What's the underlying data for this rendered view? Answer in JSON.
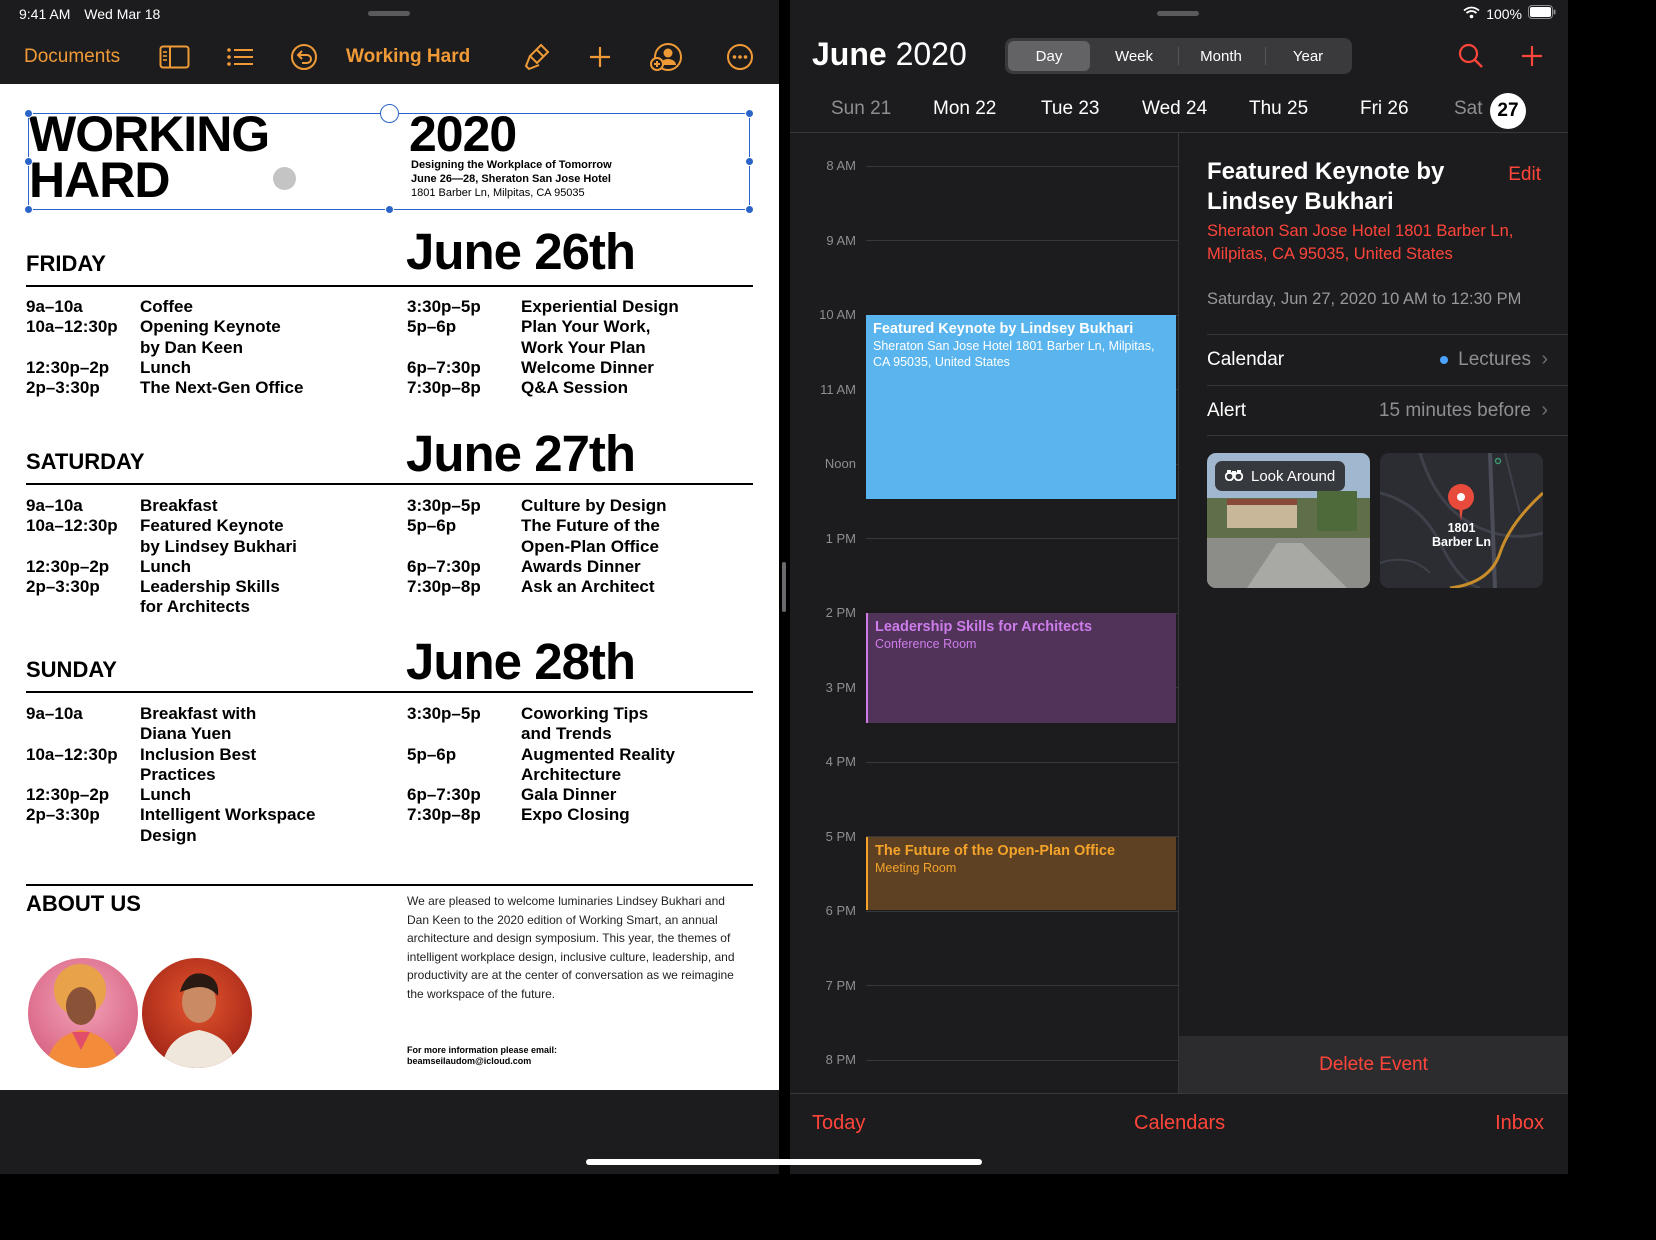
{
  "status": {
    "time": "9:41 AM",
    "date": "Wed Mar 18",
    "battery": "100%"
  },
  "pages": {
    "toolbar": {
      "documents": "Documents",
      "title": "Working Hard"
    },
    "doc": {
      "title_line1": "WORKING",
      "title_line2": "HARD",
      "year": "2020",
      "subtitle": "Designing the Workplace of Tomorrow",
      "subtitle2": "June 26—28, Sheraton San Jose Hotel",
      "address": "1801 Barber Ln, Milpitas, CA 95035",
      "days": [
        {
          "name": "FRIDAY",
          "date": "June 26th",
          "left_times": "9a–10a\n10a–12:30p\n\n12:30p–2p\n2p–3:30p",
          "left_events": "Coffee\nOpening Keynote\nby Dan Keen\nLunch\nThe Next-Gen Office",
          "right_times": "3:30p–5p\n5p–6p\n\n6p–7:30p\n7:30p–8p",
          "right_events": "Experiential Design\nPlan Your Work,\nWork Your Plan\nWelcome Dinner\nQ&A Session"
        },
        {
          "name": "SATURDAY",
          "date": "June 27th",
          "left_times": "9a–10a\n10a–12:30p\n\n12:30p–2p\n2p–3:30p",
          "left_events": "Breakfast\nFeatured Keynote\nby Lindsey Bukhari\nLunch\nLeadership Skills\nfor Architects",
          "right_times": "3:30p–5p\n5p–6p\n\n6p–7:30p\n7:30p–8p",
          "right_events": "Culture by Design\nThe Future of the\nOpen-Plan Office\nAwards Dinner\nAsk an Architect"
        },
        {
          "name": "SUNDAY",
          "date": "June 28th",
          "left_times": "9a–10a\n\n10a–12:30p\n\n12:30p–2p\n2p–3:30p",
          "left_events": "Breakfast with\nDiana Yuen\nInclusion Best\nPractices\nLunch\nIntelligent Workspace\nDesign",
          "right_times": "3:30p–5p\n\n5p–6p\n\n6p–7:30p\n7:30p–8p",
          "right_events": "Coworking Tips\nand Trends\nAugmented Reality\nArchitecture\nGala Dinner\nExpo Closing"
        }
      ],
      "about_heading": "ABOUT US",
      "about_text": "We are pleased to welcome luminaries Lindsey Bukhari and Dan Keen to the 2020 edition of Working Smart, an annual architecture and design symposium. This year, the themes of intelligent workplace design, inclusive culture, leadership, and productivity are at the center of conversation as we reimagine the workspace of the future.",
      "info_label": "For more information please email:",
      "info_email": "beamseilaudom@icloud.com"
    }
  },
  "calendar": {
    "month": "June",
    "year": "2020",
    "views": [
      "Day",
      "Week",
      "Month",
      "Year"
    ],
    "active_view": "Day",
    "days": [
      "Sun 21",
      "Mon 22",
      "Tue 23",
      "Wed 24",
      "Thu 25",
      "Fri 26",
      "Sat"
    ],
    "today_num": "27",
    "hours": [
      "8 AM",
      "9 AM",
      "10 AM",
      "11 AM",
      "Noon",
      "1 PM",
      "2 PM",
      "3 PM",
      "4 PM",
      "5 PM",
      "6 PM",
      "7 PM",
      "8 PM"
    ],
    "events": [
      {
        "title": "Featured Keynote by Lindsey Bukhari",
        "sub": "Sheraton San Jose Hotel 1801 Barber Ln, Milpitas, CA  95035, United States",
        "color": "#5ab5ee"
      },
      {
        "title": "Leadership Skills for Architects",
        "sub": "Conference Room",
        "color": "#cd7dea"
      },
      {
        "title": "The Future of the Open-Plan Office",
        "sub": "Meeting Room",
        "color": "#f4a32b"
      }
    ],
    "detail": {
      "title": "Featured Keynote by Lindsey Bukhari",
      "edit": "Edit",
      "location": "Sheraton San Jose Hotel 1801 Barber Ln, Milpitas, CA  95035, United States",
      "time": "Saturday, Jun 27, 2020  10 AM to 12:30 PM",
      "calendar_label": "Calendar",
      "calendar_value": "Lectures",
      "alert_label": "Alert",
      "alert_value": "15 minutes before",
      "look_around": "Look Around",
      "map_label": "1801\nBarber Ln",
      "delete": "Delete Event"
    },
    "bottom": {
      "today": "Today",
      "calendars": "Calendars",
      "inbox": "Inbox"
    }
  }
}
